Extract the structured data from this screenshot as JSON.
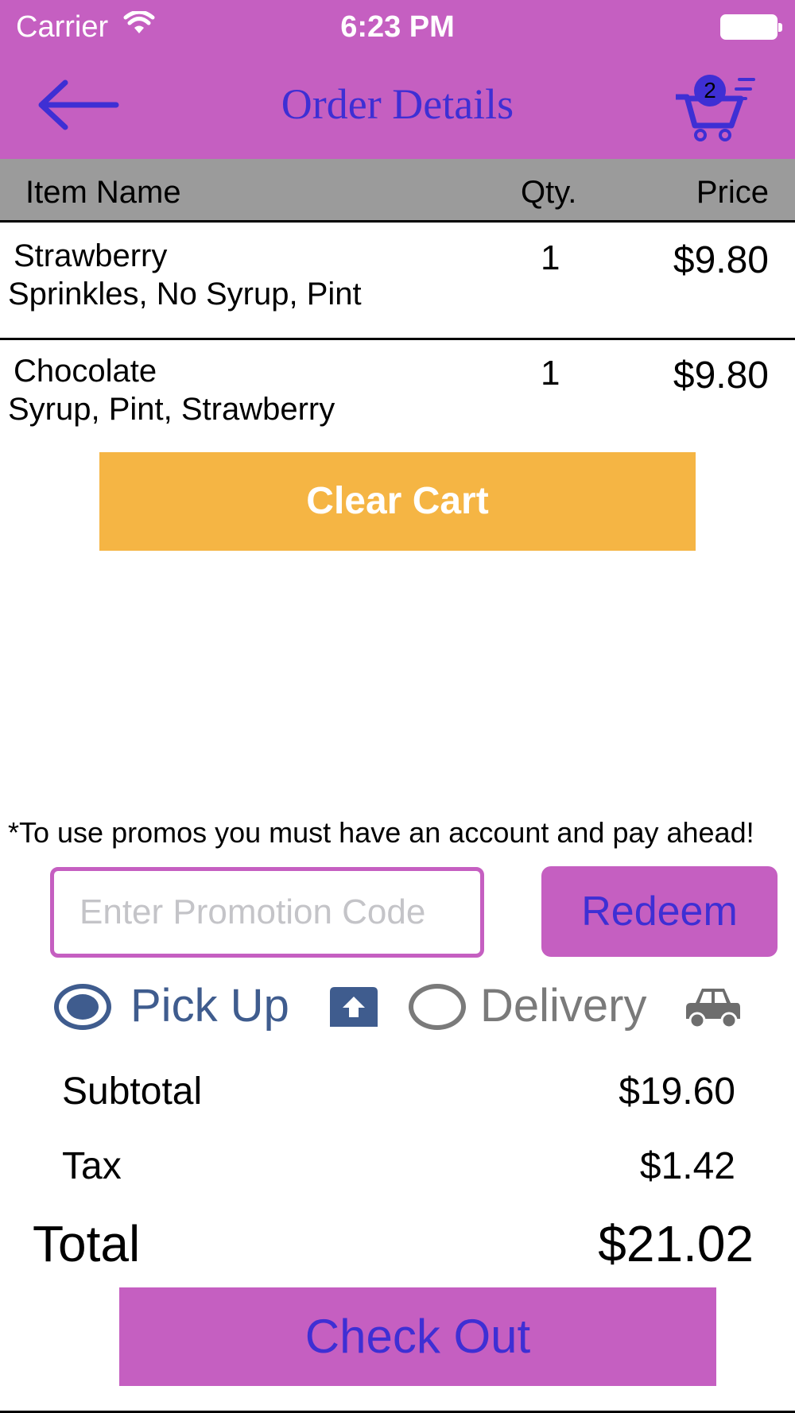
{
  "status_bar": {
    "carrier": "Carrier",
    "time": "6:23 PM"
  },
  "nav": {
    "title": "Order Details",
    "cart_count": "2"
  },
  "table": {
    "headers": {
      "item_name": "Item Name",
      "qty": "Qty.",
      "price": "Price"
    },
    "items": [
      {
        "name": "Strawberry",
        "options": "Sprinkles, No Syrup, Pint",
        "qty": "1",
        "price": "$9.80"
      },
      {
        "name": "Chocolate",
        "options": "Syrup, Pint, Strawberry",
        "qty": "1",
        "price": "$9.80"
      }
    ]
  },
  "clear_cart_label": "Clear Cart",
  "promo": {
    "note": "*To use promos you must have an account and pay ahead!",
    "placeholder": "Enter Promotion Code",
    "value": "",
    "redeem_label": "Redeem"
  },
  "fulfillment": {
    "selected": "Pick Up",
    "options": [
      "Pick Up",
      "Delivery"
    ]
  },
  "summary": {
    "subtotal_label": "Subtotal",
    "subtotal": "$19.60",
    "tax_label": "Tax",
    "tax": "$1.42",
    "total_label": "Total",
    "total": "$21.02"
  },
  "checkout_label": "Check Out",
  "colors": {
    "header": "#c55fc1",
    "accent_text": "#3e2fd4",
    "clear_cart": "#f5b544",
    "table_header": "#9b9b9b",
    "pickup": "#3f5c8e",
    "delivery": "#7a7a7a"
  },
  "icons": {
    "back": "back-arrow-icon",
    "cart": "shopping-cart-icon",
    "wifi": "wifi-icon",
    "battery": "battery-icon",
    "store": "store-icon",
    "car": "car-icon"
  }
}
